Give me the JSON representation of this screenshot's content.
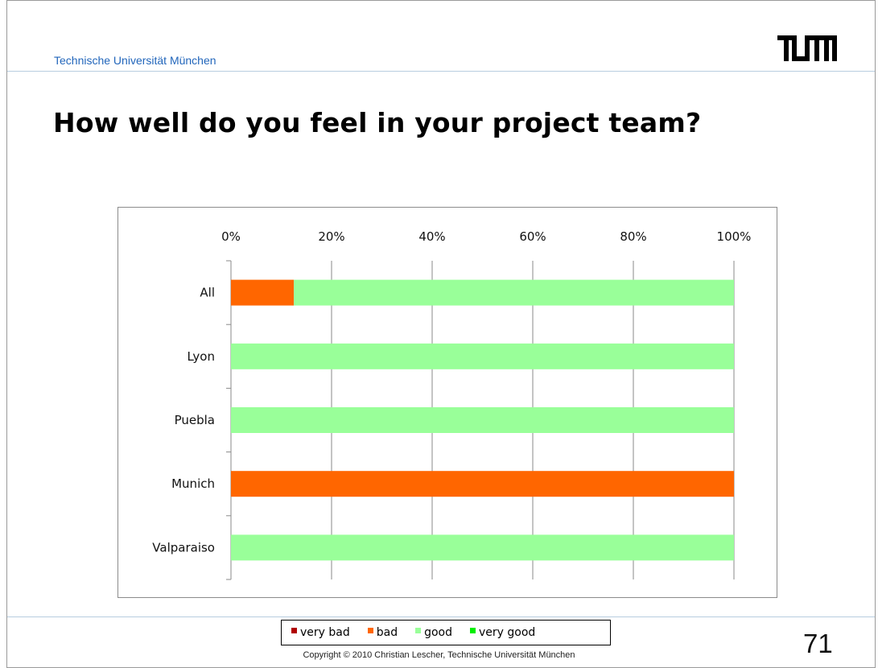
{
  "header": {
    "institution": "Technische Universität München",
    "logo_text": "TUM",
    "logo_color": "#000000"
  },
  "slide": {
    "title": "How well do you feel in your project team?",
    "page_number": "71",
    "copyright": "Copyright © 2010 Christian Lescher, Technische Universität München"
  },
  "legend": {
    "items": [
      {
        "label": "very bad",
        "color": "#b00000"
      },
      {
        "label": "bad",
        "color": "#ff6600"
      },
      {
        "label": "good",
        "color": "#99ff99"
      },
      {
        "label": "very good",
        "color": "#00ee00"
      }
    ]
  },
  "chart_data": {
    "type": "bar",
    "orientation": "horizontal",
    "stacked": "percent",
    "categories": [
      "All",
      "Lyon",
      "Puebla",
      "Munich",
      "Valparaiso"
    ],
    "series": [
      {
        "name": "very bad",
        "color": "#b00000",
        "values": [
          0,
          0,
          0,
          0,
          0
        ]
      },
      {
        "name": "bad",
        "color": "#ff6600",
        "values": [
          12.5,
          0,
          0,
          100,
          0
        ]
      },
      {
        "name": "good",
        "color": "#99ff99",
        "values": [
          87.5,
          100,
          100,
          0,
          100
        ]
      },
      {
        "name": "very good",
        "color": "#00ee00",
        "values": [
          0,
          0,
          0,
          0,
          0
        ]
      }
    ],
    "x_ticks": [
      "0%",
      "20%",
      "40%",
      "60%",
      "80%",
      "100%"
    ],
    "xlim": [
      0,
      100
    ],
    "grid": true,
    "axis_position": "top",
    "legend_placement": "bottom"
  }
}
